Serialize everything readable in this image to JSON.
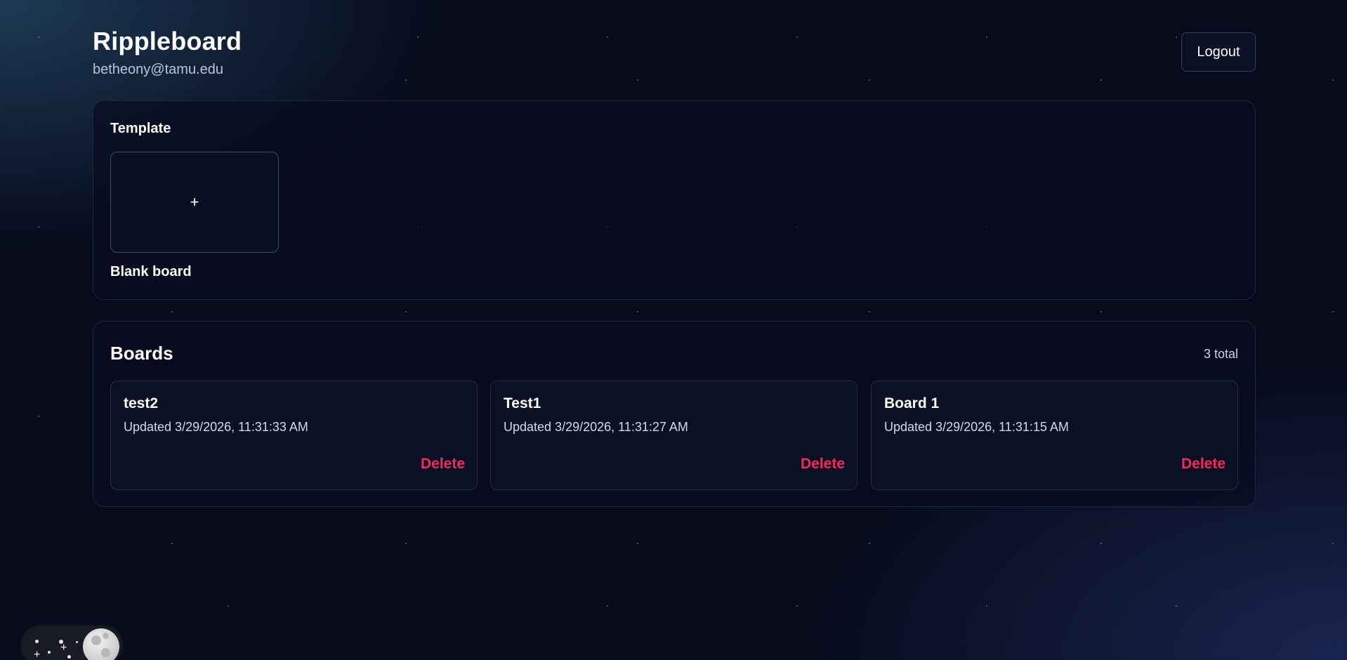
{
  "app": {
    "title": "Rippleboard",
    "user_email": "betheony@tamu.edu",
    "logout_label": "Logout"
  },
  "template_section": {
    "label": "Template",
    "blank_icon": "plus-icon",
    "blank_glyph": "+",
    "blank_label": "Blank board"
  },
  "boards_section": {
    "title": "Boards",
    "count_label": "3 total",
    "delete_label": "Delete",
    "items": [
      {
        "name": "test2",
        "updated": "Updated 3/29/2026, 11:31:33 AM"
      },
      {
        "name": "Test1",
        "updated": "Updated 3/29/2026, 11:31:27 AM"
      },
      {
        "name": "Board 1",
        "updated": "Updated 3/29/2026, 11:31:15 AM"
      }
    ]
  },
  "theme_toggle": {
    "icon": "moon-icon",
    "mode": "dark"
  },
  "colors": {
    "background": "#070b1c",
    "accent_delete": "#ef2b5c",
    "text_primary": "#ffffff",
    "text_secondary": "#b9c5d9"
  }
}
